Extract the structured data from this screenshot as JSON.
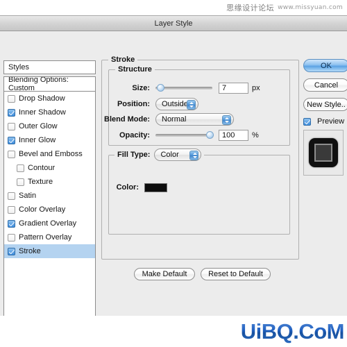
{
  "watermarks": {
    "top_cn": "思缘设计论坛",
    "top_url": "www.missyuan.com",
    "bottom_logo": "UiBQ.CoM"
  },
  "dialog": {
    "title": "Layer Style"
  },
  "sidebar": {
    "styles_header": "Styles",
    "blending_header": "Blending Options: Custom",
    "items": [
      {
        "label": "Drop Shadow",
        "checked": false,
        "indent": false,
        "selected": false
      },
      {
        "label": "Inner Shadow",
        "checked": true,
        "indent": false,
        "selected": false
      },
      {
        "label": "Outer Glow",
        "checked": false,
        "indent": false,
        "selected": false
      },
      {
        "label": "Inner Glow",
        "checked": true,
        "indent": false,
        "selected": false
      },
      {
        "label": "Bevel and Emboss",
        "checked": false,
        "indent": false,
        "selected": false
      },
      {
        "label": "Contour",
        "checked": false,
        "indent": true,
        "selected": false
      },
      {
        "label": "Texture",
        "checked": false,
        "indent": true,
        "selected": false
      },
      {
        "label": "Satin",
        "checked": false,
        "indent": false,
        "selected": false
      },
      {
        "label": "Color Overlay",
        "checked": false,
        "indent": false,
        "selected": false
      },
      {
        "label": "Gradient Overlay",
        "checked": true,
        "indent": false,
        "selected": false
      },
      {
        "label": "Pattern Overlay",
        "checked": false,
        "indent": false,
        "selected": false
      },
      {
        "label": "Stroke",
        "checked": true,
        "indent": false,
        "selected": true
      }
    ]
  },
  "main": {
    "group_title": "Stroke",
    "structure": {
      "title": "Structure",
      "size_label": "Size:",
      "size_value": "7",
      "size_unit": "px",
      "size_percent": 3,
      "position_label": "Position:",
      "position_value": "Outside",
      "blend_mode_label": "Blend Mode:",
      "blend_mode_value": "Normal",
      "opacity_label": "Opacity:",
      "opacity_value": "100",
      "opacity_unit": "%",
      "opacity_percent": 100
    },
    "fill_type": {
      "label": "Fill Type:",
      "value": "Color",
      "color_label": "Color:",
      "color_value": "#0d0d0d"
    },
    "make_default_label": "Make Default",
    "reset_default_label": "Reset to Default"
  },
  "right": {
    "ok_label": "OK",
    "cancel_label": "Cancel",
    "new_style_label": "New Style..",
    "preview_label": "Preview",
    "preview_checked": true
  }
}
